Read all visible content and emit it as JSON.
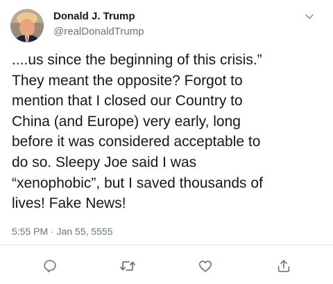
{
  "tweet": {
    "author": {
      "display_name": "Donald J. Trump",
      "handle": "@realDonaldTrump"
    },
    "text": "....us since the beginning of this crisis.”\nThey meant the opposite? Forgot to\nmention that I closed our Country to\nChina (and Europe) very early, long\nbefore it was considered acceptable to\ndo so. Sleepy Joe said I was\n“xenophobic”, but I saved thousands of\nlives! Fake News!",
    "timestamp": "5:55 PM · Jan 55, 5555"
  },
  "icons": {
    "menu": "chevron-down-icon",
    "reply": "reply-icon",
    "retweet": "retweet-icon",
    "like": "heart-icon",
    "share": "share-icon"
  },
  "colors": {
    "text": "#14171a",
    "secondary": "#657786",
    "divider": "#e1e8ed"
  }
}
